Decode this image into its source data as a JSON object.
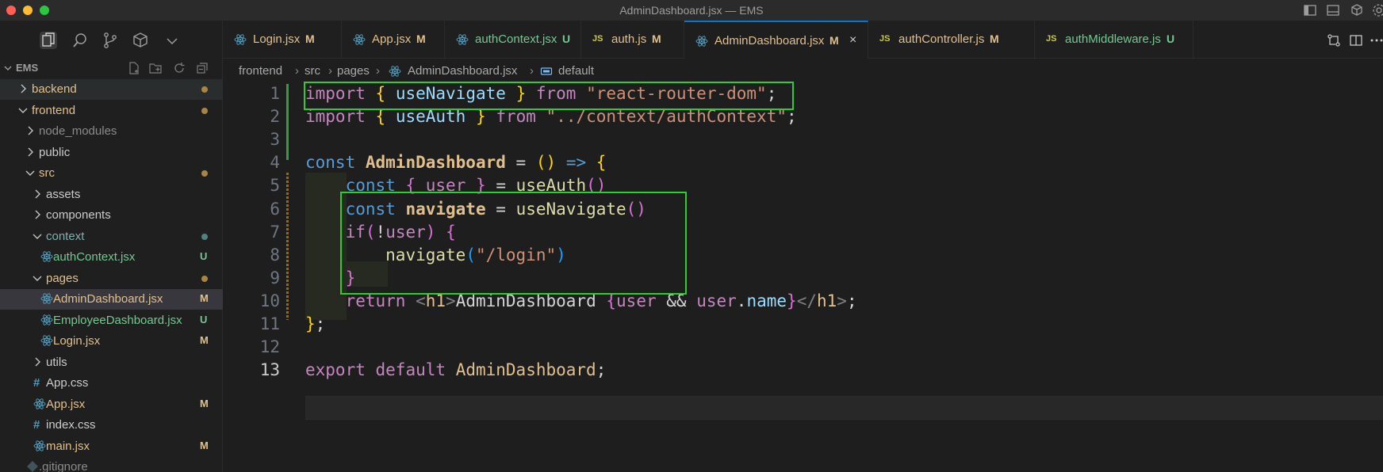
{
  "window": {
    "title": "AdminDashboard.jsx — EMS",
    "traffic_colors": [
      "#ff5f57",
      "#febc2e",
      "#28c840"
    ]
  },
  "explorer": {
    "root_label": "EMS",
    "items": [
      {
        "name": "backend",
        "kind": "folder",
        "state": "collapsed",
        "indent": 0,
        "dot": "#a9853f"
      },
      {
        "name": "frontend",
        "kind": "folder",
        "state": "expanded",
        "indent": 0,
        "dot": "#a9853f"
      },
      {
        "name": "node_modules",
        "kind": "folder",
        "state": "collapsed",
        "indent": 1
      },
      {
        "name": "public",
        "kind": "folder",
        "state": "collapsed",
        "indent": 1
      },
      {
        "name": "src",
        "kind": "folder",
        "state": "expanded",
        "indent": 1,
        "dot": "#a9853f"
      },
      {
        "name": "assets",
        "kind": "folder",
        "state": "collapsed",
        "indent": 2
      },
      {
        "name": "components",
        "kind": "folder",
        "state": "collapsed",
        "indent": 2
      },
      {
        "name": "context",
        "kind": "folder",
        "state": "expanded",
        "indent": 2,
        "dot": "#4d8383"
      },
      {
        "name": "authContext.jsx",
        "kind": "react",
        "indent": 3,
        "badge": "U"
      },
      {
        "name": "pages",
        "kind": "folder",
        "state": "expanded",
        "indent": 2,
        "dot": "#a9853f"
      },
      {
        "name": "AdminDashboard.jsx",
        "kind": "react",
        "indent": 3,
        "badge": "M"
      },
      {
        "name": "EmployeeDashboard.jsx",
        "kind": "react",
        "indent": 3,
        "badge": "U"
      },
      {
        "name": "Login.jsx",
        "kind": "react",
        "indent": 3,
        "badge": "M"
      },
      {
        "name": "utils",
        "kind": "folder",
        "state": "collapsed",
        "indent": 2
      },
      {
        "name": "App.css",
        "kind": "css",
        "indent": 2
      },
      {
        "name": "App.jsx",
        "kind": "react",
        "indent": 2,
        "badge": "M"
      },
      {
        "name": "index.css",
        "kind": "css",
        "indent": 2
      },
      {
        "name": "main.jsx",
        "kind": "react",
        "indent": 2,
        "badge": "M"
      },
      {
        "name": ".gitignore",
        "kind": "git",
        "indent": 1
      }
    ]
  },
  "tabs": [
    {
      "label": "Login.jsx",
      "type": "react",
      "badge": "M"
    },
    {
      "label": "App.jsx",
      "type": "react",
      "badge": "M"
    },
    {
      "label": "authContext.jsx",
      "type": "react",
      "badge": "U"
    },
    {
      "label": "auth.js",
      "type": "js",
      "badge": "M"
    },
    {
      "label": "AdminDashboard.jsx",
      "type": "react",
      "badge": "M",
      "active": true
    },
    {
      "label": "authController.js",
      "type": "js",
      "badge": "M"
    },
    {
      "label": "authMiddleware.js",
      "type": "js",
      "badge": "U"
    }
  ],
  "tab_js_label": "JS",
  "tab_close_glyph": "×",
  "breadcrumb": {
    "parts": [
      "frontend",
      "src",
      "pages",
      "AdminDashboard.jsx",
      "default"
    ]
  },
  "editor": {
    "line_numbers": [
      "1",
      "2",
      "3",
      "4",
      "5",
      "6",
      "7",
      "8",
      "9",
      "10",
      "11",
      "12",
      "13"
    ],
    "current_line": 13,
    "tokens": {
      "import": "import",
      "from": "from",
      "useNavigate": "useNavigate",
      "react_router": "\"react-router-dom\"",
      "useAuth": "useAuth",
      "context_path": "\"../context/authContext\"",
      "const": "const",
      "AdminDashboard": "AdminDashboard",
      "user": "user",
      "navigate": "navigate",
      "if": "if",
      "login_path": "\"/login\"",
      "return": "return",
      "h1": "h1",
      "text_AdminDashboard": "AdminDashboard",
      "name": "name",
      "export": "export",
      "default": "default"
    }
  },
  "colors": {
    "modified": "#e2c08d",
    "untracked": "#73c991",
    "react_icon": "#519aba",
    "highlight_box": "#2bd12b"
  }
}
